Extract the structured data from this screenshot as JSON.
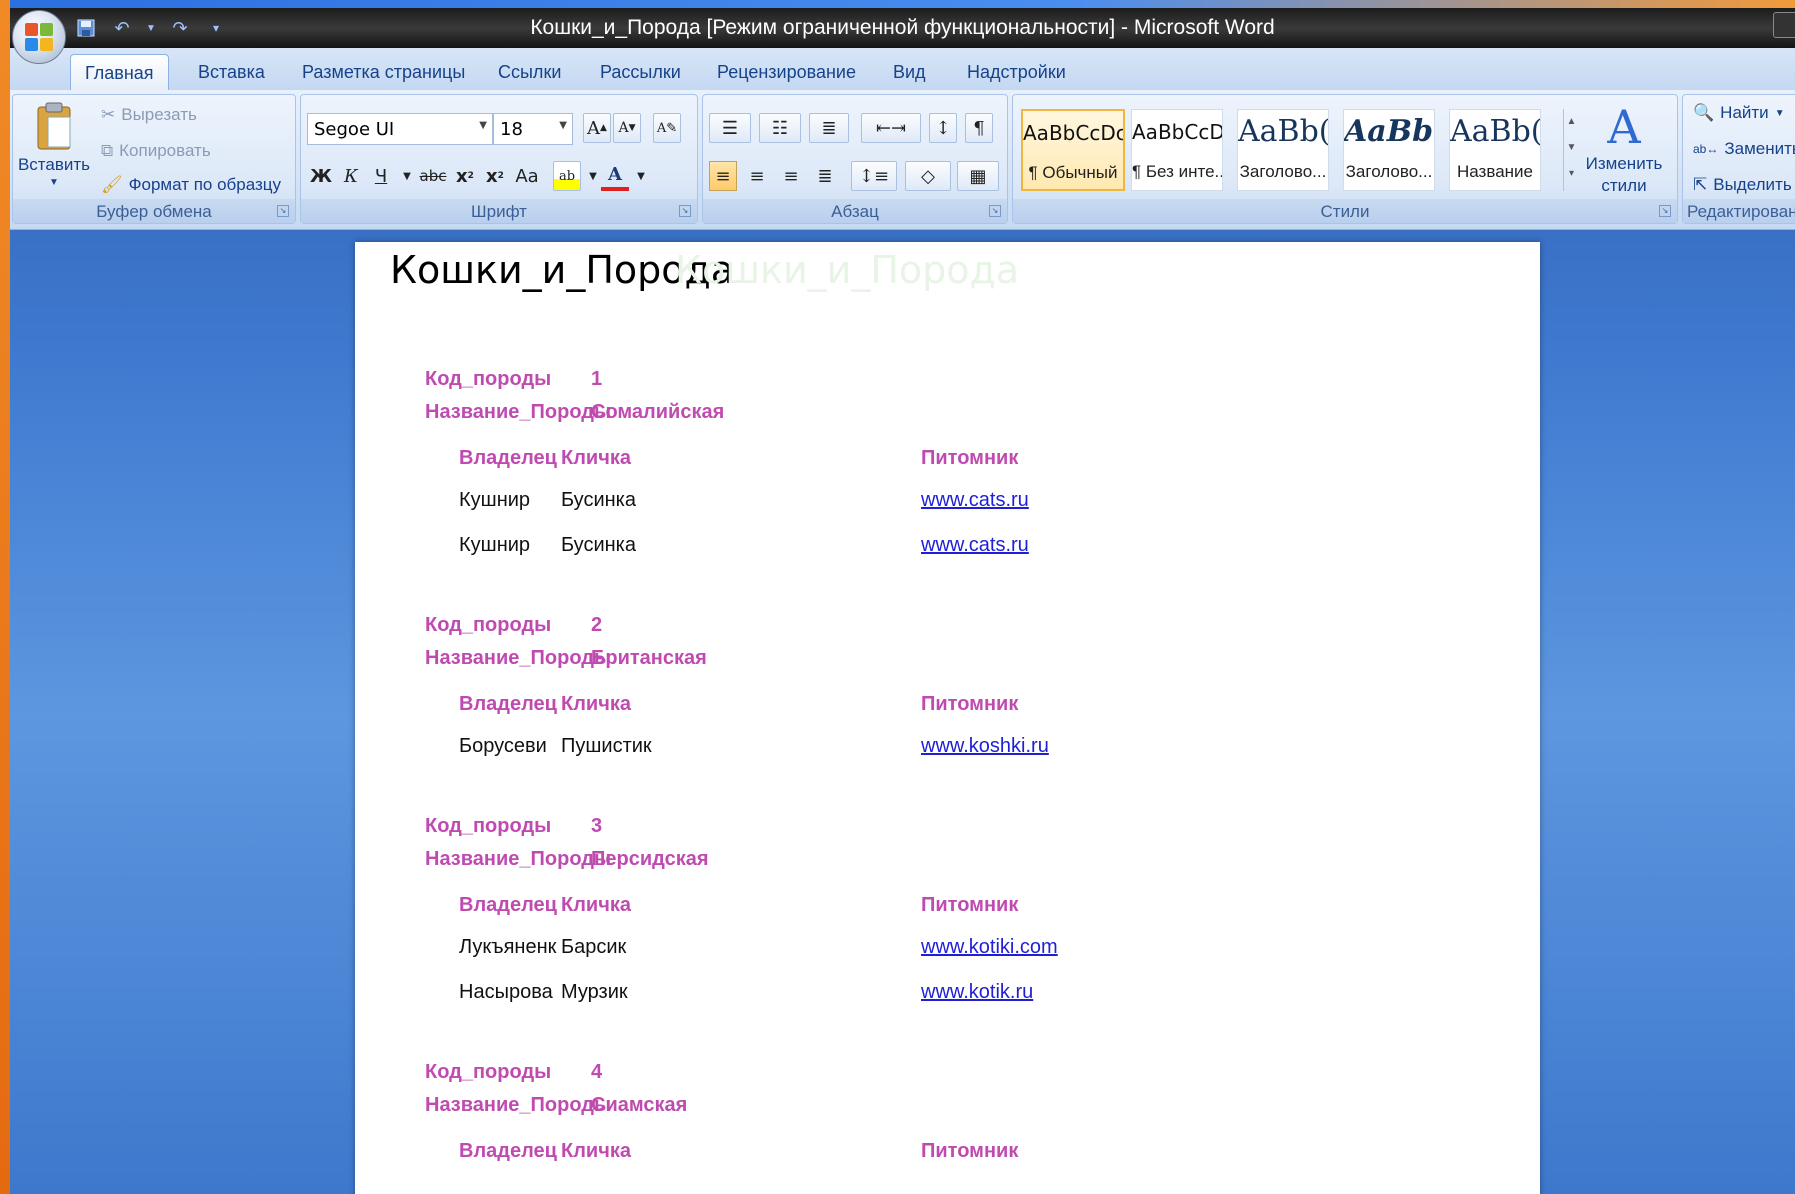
{
  "window": {
    "title": "Кошки_и_Порода [Режим ограниченной функциональности] - Microsoft Word"
  },
  "tabs": [
    "Главная",
    "Вставка",
    "Разметка страницы",
    "Ссылки",
    "Рассылки",
    "Рецензирование",
    "Вид",
    "Надстройки"
  ],
  "ribbon": {
    "clipboard": {
      "label": "Буфер обмена",
      "paste": "Вставить",
      "cut": "Вырезать",
      "copy": "Копировать",
      "format_painter": "Формат по образцу"
    },
    "font": {
      "label": "Шрифт",
      "family": "Segoe UI",
      "size": "18"
    },
    "paragraph": {
      "label": "Абзац"
    },
    "styles": {
      "label": "Стили",
      "items": [
        {
          "sample": "AaBbCcDc",
          "name": "¶ Обычный"
        },
        {
          "sample": "AaBbCcDc",
          "name": "¶ Без инте..."
        },
        {
          "sample": "AaBb(",
          "name": "Заголово..."
        },
        {
          "sample": "AaBbCi",
          "name": "Заголово..."
        },
        {
          "sample": "AaBb(",
          "name": "Название"
        }
      ],
      "change_styles": "Изменить стили"
    },
    "editing": {
      "label": "Редактировани",
      "find": "Найти",
      "replace": "Заменить",
      "select": "Выделить"
    }
  },
  "colors": {
    "field_label": "#c04bb0",
    "link": "#1f1fd6",
    "highlight": "#ffff00",
    "font_color": "#e02020"
  },
  "report": {
    "title": "Кошки_и_Порода",
    "ghost_title": "Кошки_и_Порода",
    "breed_code_label": "Код_породы",
    "breed_name_label": "Название_Породы",
    "col_owner": "Владелец",
    "col_nickname": "Кличка",
    "col_nursery": "Питомник",
    "groups": [
      {
        "code": "1",
        "name": "Сомалийская",
        "rows": [
          {
            "owner": "Кушнир",
            "nickname": "Бусинка",
            "nursery": "www.cats.ru"
          },
          {
            "owner": "Кушнир",
            "nickname": "Бусинка",
            "nursery": "www.cats.ru"
          }
        ]
      },
      {
        "code": "2",
        "name": "Британская",
        "rows": [
          {
            "owner": "Борусеви",
            "nickname": "Пушистик",
            "nursery": "www.koshki.ru"
          }
        ]
      },
      {
        "code": "3",
        "name": "Персидская",
        "rows": [
          {
            "owner": "Лукъяненк",
            "nickname": "Барсик",
            "nursery": "www.kotiki.com"
          },
          {
            "owner": "Насырова",
            "nickname": "Мурзик",
            "nursery": "www.kotik.ru"
          }
        ]
      },
      {
        "code": "4",
        "name": "Сиамская",
        "rows": []
      }
    ]
  }
}
